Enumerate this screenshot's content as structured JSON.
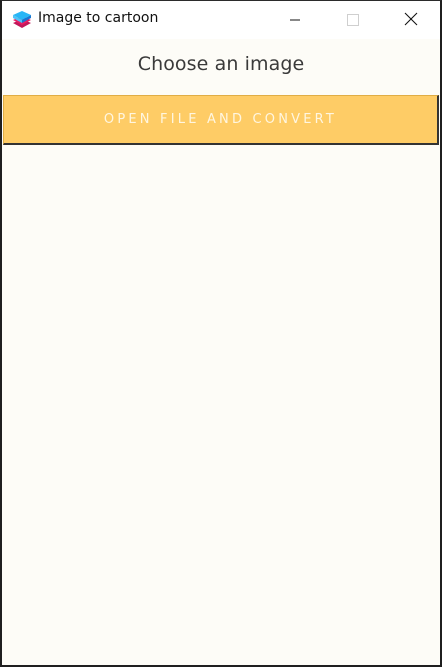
{
  "window": {
    "title": "Image to cartoon",
    "icon": "stacked-layers-icon",
    "controls": {
      "minimize": "minimize-icon",
      "maximize": "maximize-icon",
      "close": "close-icon"
    }
  },
  "main": {
    "heading": "Choose an image",
    "convert_button_label": "OPEN FILE AND CONVERT"
  },
  "colors": {
    "background": "#fdfcf7",
    "button": "#fecc66",
    "button_text": "#fff6e0",
    "heading_text": "#3a3a3a"
  }
}
